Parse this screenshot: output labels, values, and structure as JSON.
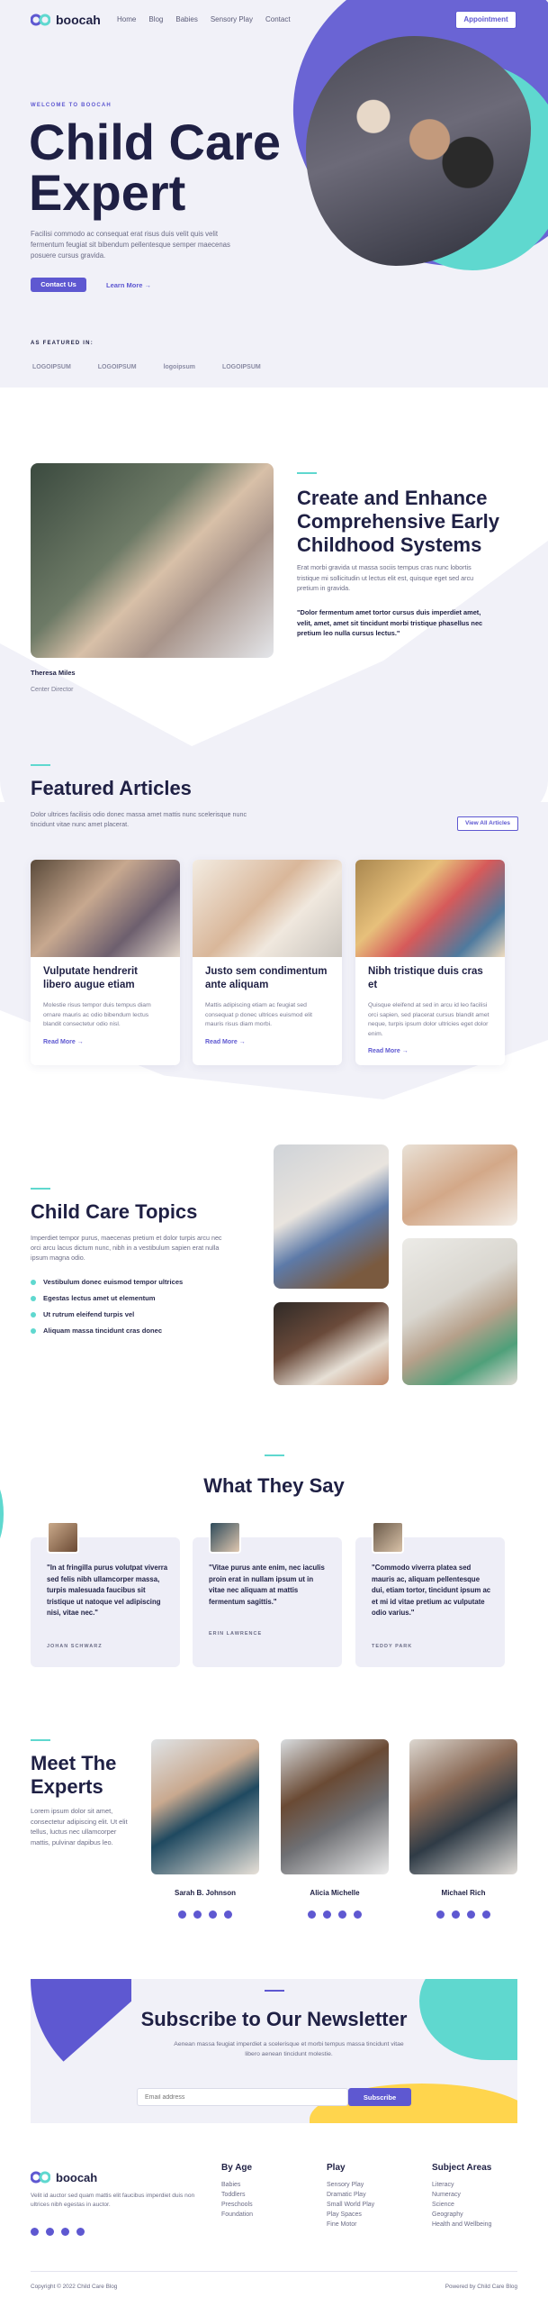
{
  "brand": {
    "name": "boocah"
  },
  "nav": {
    "items": [
      "Home",
      "Blog",
      "Babies",
      "Sensory Play",
      "Contact"
    ],
    "cta": "Appointment"
  },
  "hero": {
    "eyebrow": "WELCOME TO BOOCAH",
    "title_line1": "Child Care",
    "title_line2": "Expert",
    "text": "Facilisi commodo ac consequat erat risus duis velit quis velit fermentum feugiat sit bibendum pellentesque semper maecenas posuere cursus gravida.",
    "primary_btn": "Contact Us",
    "secondary_btn": "Learn More"
  },
  "featured_in": {
    "label": "AS FEATURED IN:",
    "logos": [
      "LOGOIPSUM",
      "LOGOIPSUM",
      "logoipsum",
      "LOGOIPSUM"
    ]
  },
  "about": {
    "person_name": "Theresa Miles",
    "person_role": "Center Director",
    "title": "Create and Enhance Comprehensive Early Childhood Systems",
    "text": "Erat morbi gravida ut massa sociis tempus cras nunc lobortis tristique mi sollicitudin ut lectus elit est, quisque eget sed arcu pretium in gravida.",
    "quote": "\"Dolor fermentum amet tortor cursus duis imperdiet amet, velit, amet, amet sit tincidunt morbi tristique phasellus nec pretium leo nulla cursus lectus.\""
  },
  "articles": {
    "title": "Featured Articles",
    "text": "Dolor ultrices facilisis odio donec massa amet mattis nunc scelerisque nunc tincidunt vitae nunc amet placerat.",
    "view_all": "View All Articles",
    "items": [
      {
        "title": "Vulputate hendrerit libero augue etiam",
        "text": "Molestie risus tempor duis tempus diam ornare mauris ac odio bibendum lectus blandit consectetur odio nisl.",
        "link": "Read More"
      },
      {
        "title": "Justo sem condimentum ante aliquam",
        "text": "Mattis adipiscing etiam ac feugiat sed consequat p donec ultrices euismod elit mauris risus diam morbi.",
        "link": "Read More"
      },
      {
        "title": "Nibh tristique duis cras et",
        "text": "Quisque eleifend at sed in arcu id leo facilisi orci sapien, sed placerat cursus blandit amet neque, turpis ipsum dolor ultricies eget dolor enim.",
        "link": "Read More"
      }
    ]
  },
  "topics": {
    "title": "Child Care Topics",
    "text": "Imperdiet tempor purus, maecenas pretium et dolor turpis arcu nec orci arcu lacus dictum nunc, nibh in a vestibulum sapien erat nulla ipsum magna odio.",
    "items": [
      "Vestibulum donec euismod tempor ultrices",
      "Egestas lectus amet ut elementum",
      "Ut rutrum eleifend turpis vel",
      "Aliquam massa tincidunt cras donec"
    ]
  },
  "testimonials": {
    "title": "What They Say",
    "items": [
      {
        "quote": "\"In at fringilla purus volutpat viverra sed felis nibh ullamcorper massa, turpis malesuada faucibus sit tristique ut natoque vel adipiscing nisi, vitae nec.\"",
        "name": "JOHAN SCHWARZ"
      },
      {
        "quote": "\"Vitae purus ante enim, nec iaculis proin erat in nullam ipsum ut in vitae nec aliquam at mattis fermentum sagittis.\"",
        "name": "ERIN LAWRENCE"
      },
      {
        "quote": "\"Commodo viverra platea sed mauris ac, aliquam pellentesque dui, etiam tortor, tincidunt ipsum ac et mi id vitae pretium ac vulputate odio varius.\"",
        "name": "TEDDY PARK"
      }
    ]
  },
  "experts": {
    "title": "Meet The Experts",
    "text": "Lorem ipsum dolor sit amet, consectetur adipiscing elit. Ut elit tellus, luctus nec ullamcorper mattis, pulvinar dapibus leo.",
    "items": [
      {
        "name": "Sarah B. Johnson"
      },
      {
        "name": "Alicia Michelle"
      },
      {
        "name": "Michael Rich"
      }
    ]
  },
  "newsletter": {
    "title": "Subscribe to Our Newsletter",
    "text": "Aenean massa feugiat imperdiet a scelerisque et morbi tempus massa tincidunt vitae libero aenean tincidunt molestie.",
    "placeholder": "Email address",
    "button": "Subscribe"
  },
  "footer": {
    "text": "Velit id auctor sed quam mattis elit faucibus imperdiet duis non ultrices nibh egestas in auctor.",
    "cols": [
      {
        "title": "By Age",
        "links": [
          "Babies",
          "Toddlers",
          "Preschools",
          "Foundation"
        ]
      },
      {
        "title": "Play",
        "links": [
          "Sensory Play",
          "Dramatic Play",
          "Small World Play",
          "Play Spaces",
          "Fine Motor"
        ]
      },
      {
        "title": "Subject Areas",
        "links": [
          "Literacy",
          "Numeracy",
          "Science",
          "Geography",
          "Health and Wellbeing"
        ]
      }
    ],
    "copyright": "Copyright © 2022 Child Care Blog",
    "powered": "Powered by Child Care Blog"
  },
  "colors": {
    "primary": "#5e58d1",
    "accent": "#5fd8cf",
    "dark": "#1f2044",
    "yellow": "#ffd54d",
    "bg": "#f1f1f8"
  }
}
